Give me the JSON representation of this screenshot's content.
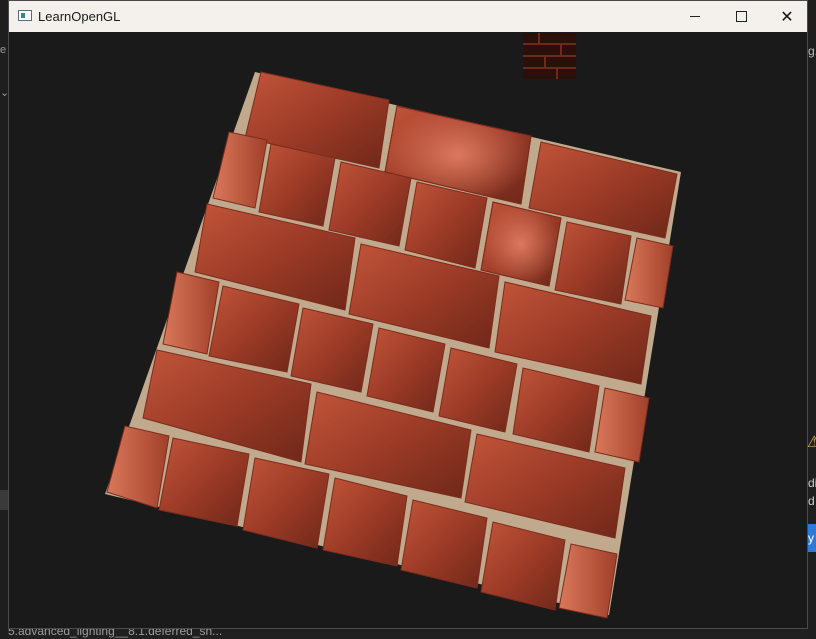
{
  "window": {
    "title": "LearnOpenGL",
    "controls": {
      "minimize": "minimize",
      "maximize": "maximize",
      "close": "close"
    }
  },
  "background": {
    "right_edge_text_1": "g.",
    "right_edge_text_2": "di",
    "right_edge_text_3": "d",
    "right_edge_button": "y",
    "taskbar_item": "5.advanced_lighting__8.1.deferred_sh..."
  },
  "scene": {
    "description_colors": {
      "brick": "#a9422c",
      "mortar": "#e6c9a8",
      "clear": "#1a1a1a"
    }
  }
}
